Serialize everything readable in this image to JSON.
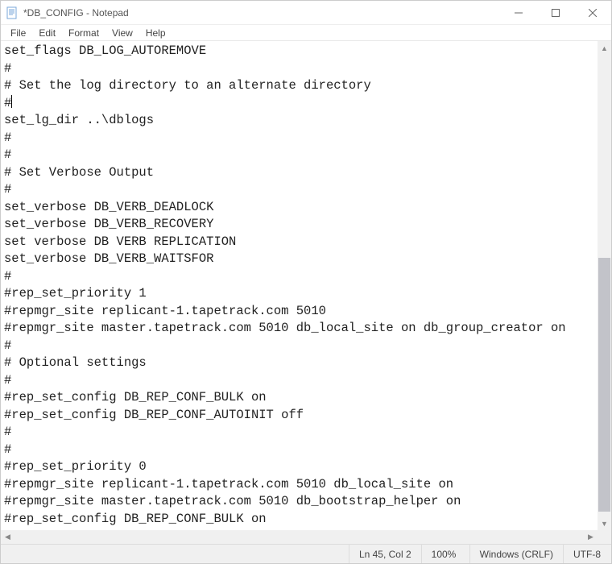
{
  "window": {
    "title": "*DB_CONFIG - Notepad"
  },
  "menu": {
    "file": "File",
    "edit": "Edit",
    "format": "Format",
    "view": "View",
    "help": "Help"
  },
  "editor": {
    "lines": [
      "set_flags DB_LOG_AUTOREMOVE",
      "#",
      "# Set the log directory to an alternate directory",
      "#",
      "set_lg_dir ..\\dblogs",
      "#",
      "#",
      "# Set Verbose Output",
      "#",
      "set_verbose DB_VERB_DEADLOCK",
      "set_verbose DB_VERB_RECOVERY",
      "set verbose DB VERB REPLICATION",
      "set_verbose DB_VERB_WAITSFOR",
      "#",
      "#rep_set_priority 1",
      "#repmgr_site replicant-1.tapetrack.com 5010",
      "#repmgr_site master.tapetrack.com 5010 db_local_site on db_group_creator on",
      "#",
      "# Optional settings",
      "#",
      "#rep_set_config DB_REP_CONF_BULK on",
      "#rep_set_config DB_REP_CONF_AUTOINIT off",
      "#",
      "#",
      "#rep_set_priority 0",
      "#repmgr_site replicant-1.tapetrack.com 5010 db_local_site on",
      "#repmgr_site master.tapetrack.com 5010 db_bootstrap_helper on",
      "#rep_set_config DB_REP_CONF_BULK on"
    ],
    "caret_line_index": 3,
    "caret_col": 5
  },
  "status": {
    "position": "Ln 45, Col 2",
    "zoom": "100%",
    "line_ending": "Windows (CRLF)",
    "encoding": "UTF-8"
  }
}
